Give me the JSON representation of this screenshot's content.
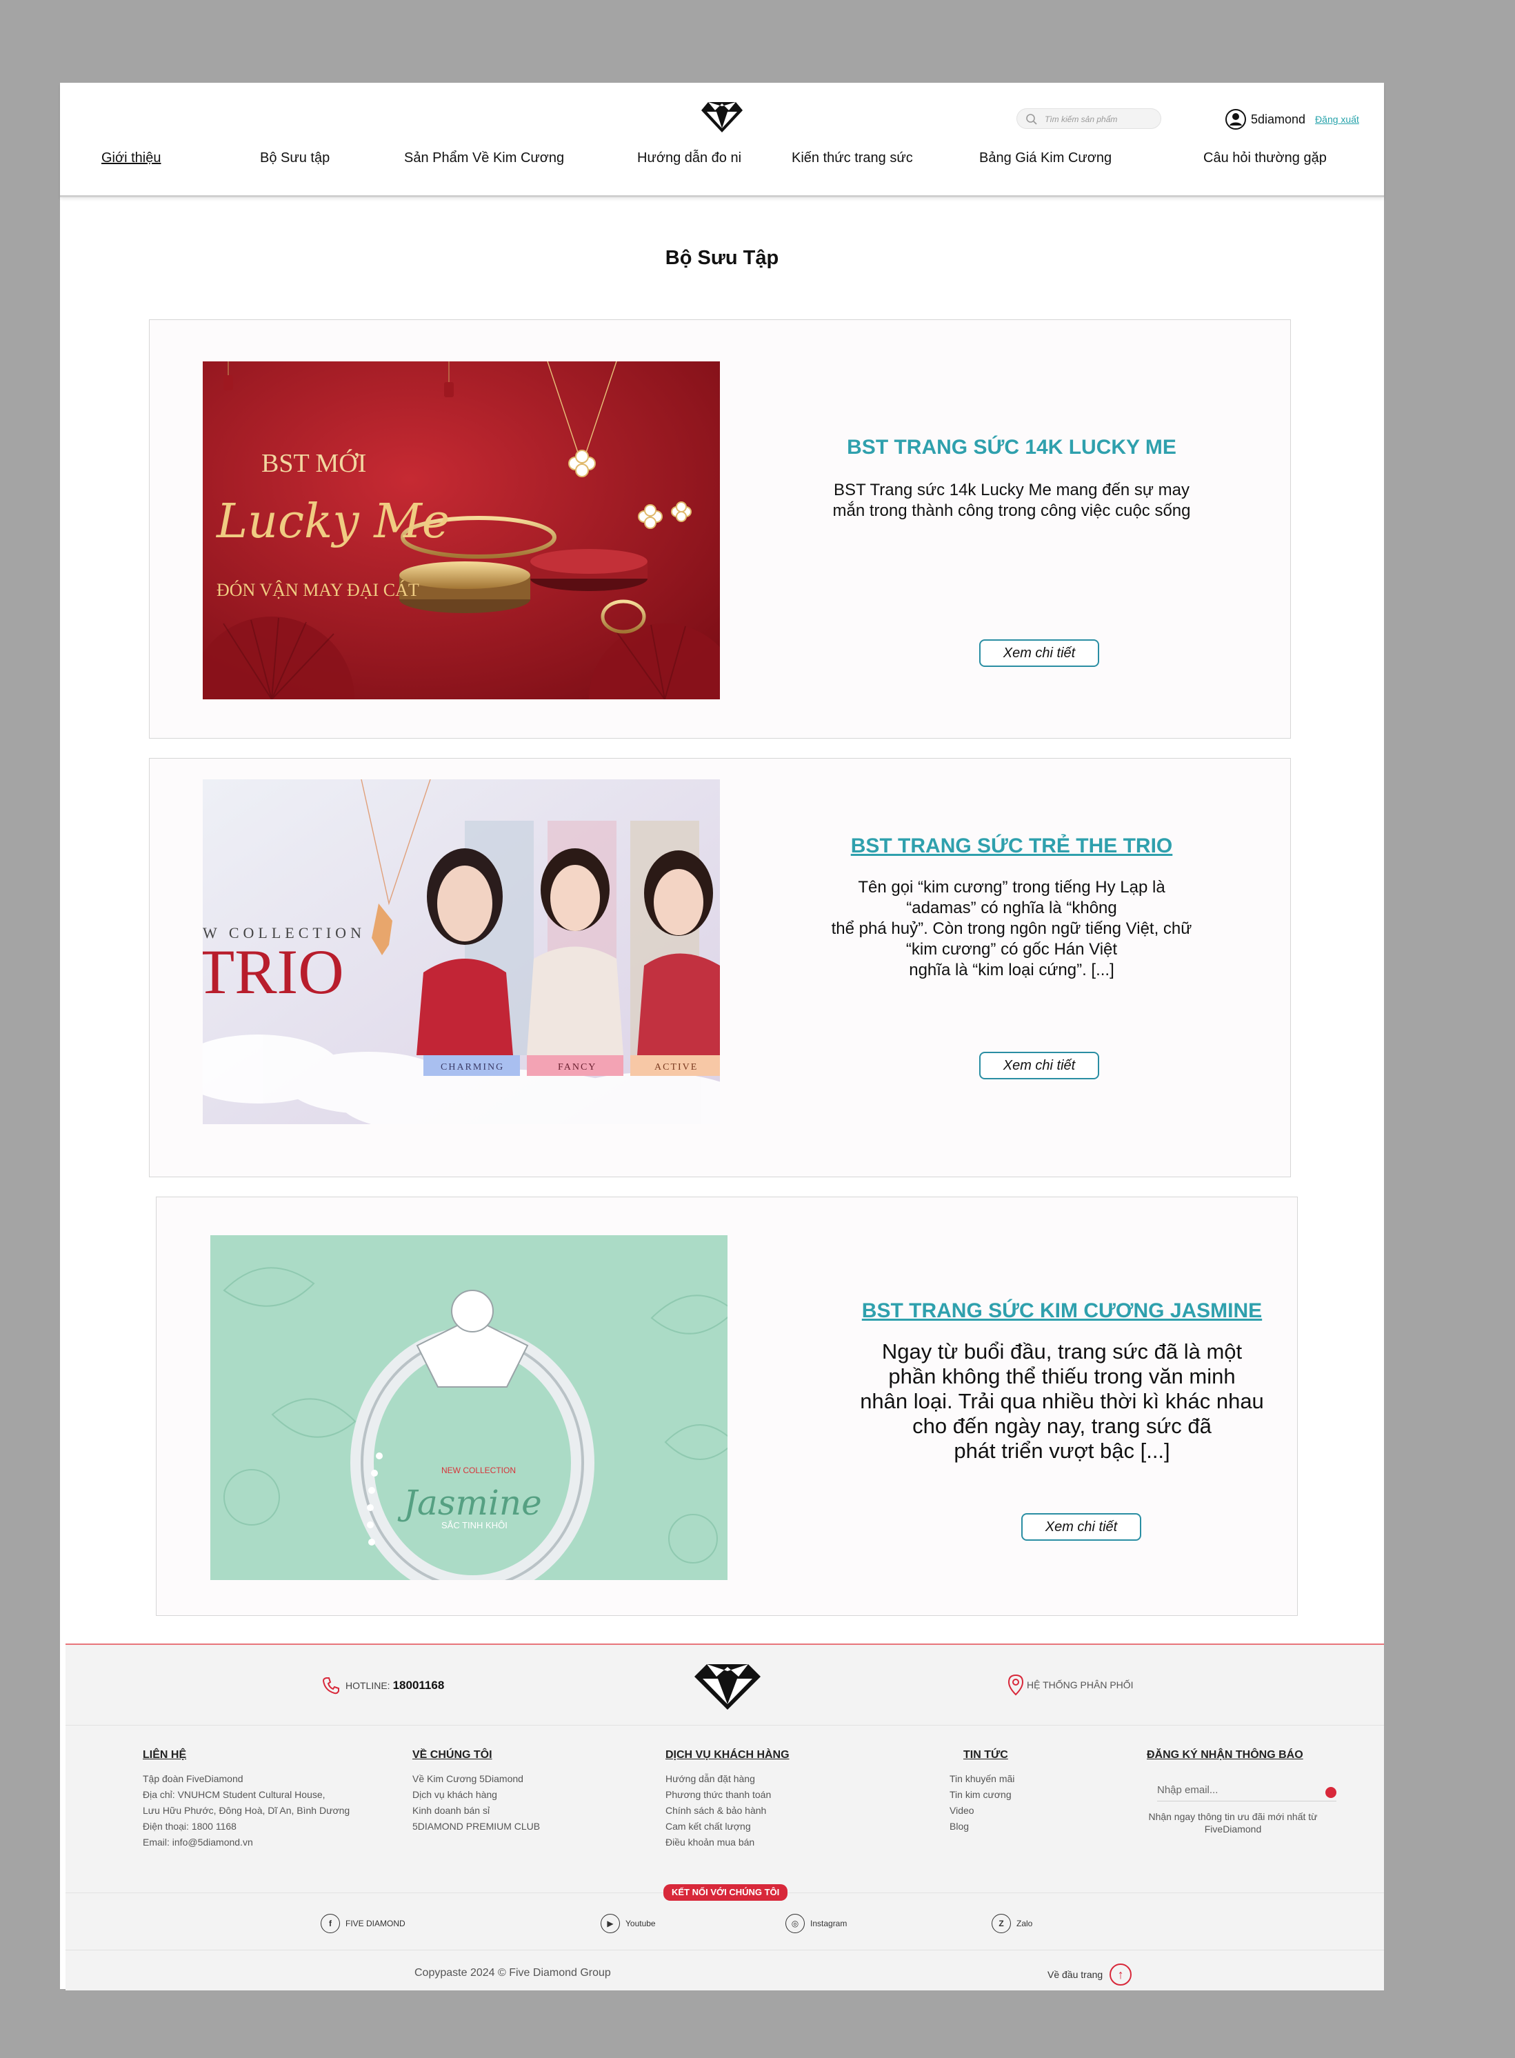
{
  "header": {
    "search_placeholder": "Tìm kiếm sản phẩm",
    "user_name": "5diamond",
    "logout_label": "Đăng xuất"
  },
  "nav": [
    {
      "label": "Giới thiệu"
    },
    {
      "label": "Bộ Sưu tập"
    },
    {
      "label": "Sản Phẩm Về Kim Cương"
    },
    {
      "label": "Hướng dẫn đo ni"
    },
    {
      "label": "Kiến thức trang sức"
    },
    {
      "label": "Bảng Giá Kim Cương"
    },
    {
      "label": "Câu hỏi thường gặp"
    }
  ],
  "page_title": "Bộ Sưu Tập",
  "collections": [
    {
      "title": "BST TRANG SỨC 14K LUCKY ME",
      "description": "BST Trang sức 14k Lucky Me mang đến sự may\nmắn trong thành công trong công việc cuộc sống",
      "button": "Xem chi tiết",
      "image_text": {
        "line1": "BST MỚI",
        "line2": "Lucky Me",
        "line3": "ĐÓN VẬN MAY ĐẠI CÁT"
      }
    },
    {
      "title": "BST TRANG SỨC TRẺ THE TRIO",
      "description": "Tên gọi “kim cương” trong tiếng Hy Lạp là\n“adamas” có nghĩa là “không\nthể phá huỷ”. Còn trong ngôn ngữ tiếng Việt, chữ\n“kim cương” có gốc Hán Việt\nnghĩa là “kim loại cứng”. [...]",
      "button": "Xem chi tiết",
      "image_text": {
        "line1": "W COLLECTION",
        "line2": "TRIO",
        "tags": [
          "CHARMING",
          "FANCY",
          "ACTIVE"
        ]
      }
    },
    {
      "title": "BST TRANG SỨC KIM CƯƠNG JASMINE",
      "description": "Ngay từ buổi đầu, trang sức đã là một\nphần không thể thiếu trong văn minh\nnhân loại. Trải qua nhiều thời kì khác nhau\ncho đến ngày nay, trang sức đã\nphát triển vượt bậc [...]",
      "button": "Xem chi tiết",
      "image_text": {
        "line1": "NEW COLLECTION",
        "line2": "Jasmine",
        "line3": "SẮC TINH KHÔI"
      }
    }
  ],
  "footer": {
    "hotline_label": "HOTLINE:",
    "hotline_number": "18001168",
    "distribution": "HỆ THỐNG PHÂN PHỐI",
    "columns": [
      {
        "title": "LIÊN HỆ",
        "items": [
          "Tập đoàn FiveDiamond",
          "Địa chỉ:  VNUHCM Student Cultural House,",
          "Lưu Hữu Phước, Đông Hoà, Dĩ An, Bình Dương",
          "Điện thoại: 1800 1168",
          "Email: info@5diamond.vn"
        ]
      },
      {
        "title": "VỀ CHÚNG TÔI",
        "items": [
          "Về Kim Cương 5Diamond",
          "Dịch vụ khách hàng",
          "Kinh doanh bán sỉ",
          "5DIAMOND PREMIUM CLUB"
        ]
      },
      {
        "title": "DỊCH VỤ KHÁCH HÀNG",
        "items": [
          "Hướng dẫn đặt hàng",
          "Phương thức thanh toán",
          "Chính sách & bảo hành",
          "Cam kết chất lượng",
          "Điều khoản mua bán"
        ]
      },
      {
        "title": "TIN TỨC",
        "items": [
          "Tin khuyến mãi",
          "Tin kim cương",
          "Video",
          "Blog"
        ]
      },
      {
        "title": "ĐĂNG KÝ NHẬN THÔNG BÁO",
        "items": []
      }
    ],
    "email_placeholder": "Nhập email...",
    "newsletter_note": "Nhận ngay thông tin ưu đãi mới nhất từ FiveDiamond",
    "connect_label": "KẾT NỐI VỚI CHÚNG TÔI",
    "social": [
      {
        "label": "FIVE DIAMOND",
        "icon": "facebook-icon",
        "glyph": "f"
      },
      {
        "label": "Youtube",
        "icon": "youtube-icon",
        "glyph": "▶"
      },
      {
        "label": "Instagram",
        "icon": "instagram-icon",
        "glyph": "◎"
      },
      {
        "label": "Zalo",
        "icon": "zalo-icon",
        "glyph": "Z"
      }
    ],
    "copyright": "Copypaste 2024 © Five Diamond Group",
    "back_to_top": "Về đầu trang"
  }
}
